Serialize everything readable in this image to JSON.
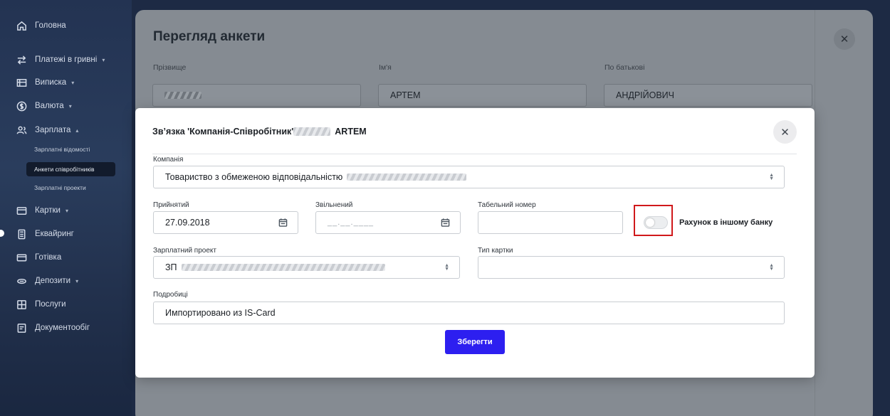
{
  "sidebar": {
    "items": [
      {
        "label": "Головна",
        "icon": "home-icon"
      },
      {
        "label": "Платежі в гривні",
        "icon": "transfer-icon",
        "caret": "▾"
      },
      {
        "label": "Виписка",
        "icon": "statement-icon",
        "caret": "▾"
      },
      {
        "label": "Валюта",
        "icon": "currency-icon",
        "caret": "▾"
      },
      {
        "label": "Зарплата",
        "icon": "people-icon",
        "caret": "▴"
      },
      {
        "label": "Картки",
        "icon": "card-icon",
        "caret": "▾"
      },
      {
        "label": "Еквайринг",
        "icon": "terminal-icon"
      },
      {
        "label": "Готівка",
        "icon": "cash-icon"
      },
      {
        "label": "Депозити",
        "icon": "deposit-icon",
        "caret": "▾"
      },
      {
        "label": "Послуги",
        "icon": "services-icon"
      },
      {
        "label": "Документообіг",
        "icon": "document-icon"
      }
    ],
    "subitems": [
      {
        "label": "Зарплатні відомості"
      },
      {
        "label": "Анкети співробітників"
      },
      {
        "label": "Зарплатні проекти"
      }
    ]
  },
  "background_panel": {
    "title": "Перегляд анкети",
    "fields": [
      {
        "label": "Прізвище",
        "value": ""
      },
      {
        "label": "Ім'я",
        "value": "АРТЕМ"
      },
      {
        "label": "По батькові",
        "value": "АНДРІЙОВИЧ"
      }
    ],
    "close": "✕"
  },
  "modal": {
    "title_prefix": "Зв’язка 'Компанія-Співробітник'",
    "title_suffix": "ARTEM",
    "close": "✕",
    "company": {
      "label": "Компанія",
      "value": "Товариство з обмеженою відповідальністю"
    },
    "hired": {
      "label": "Прийнятий",
      "value": "27.09.2018"
    },
    "fired": {
      "label": "Звільнений",
      "placeholder": "__.__.____"
    },
    "tab_number": {
      "label": "Табельний номер",
      "value": ""
    },
    "other_bank": {
      "label": "Рахунок в іншому банку",
      "checked": false
    },
    "salary_project": {
      "label": "Зарплатний проект",
      "value": "ЗП"
    },
    "card_type": {
      "label": "Тип картки",
      "value": ""
    },
    "details": {
      "label": "Подробиці",
      "value": "Импортировано из IS-Card"
    },
    "save": "Зберегти",
    "colors": {
      "accent": "#2d1ff0",
      "highlight": "#d0191b"
    }
  }
}
